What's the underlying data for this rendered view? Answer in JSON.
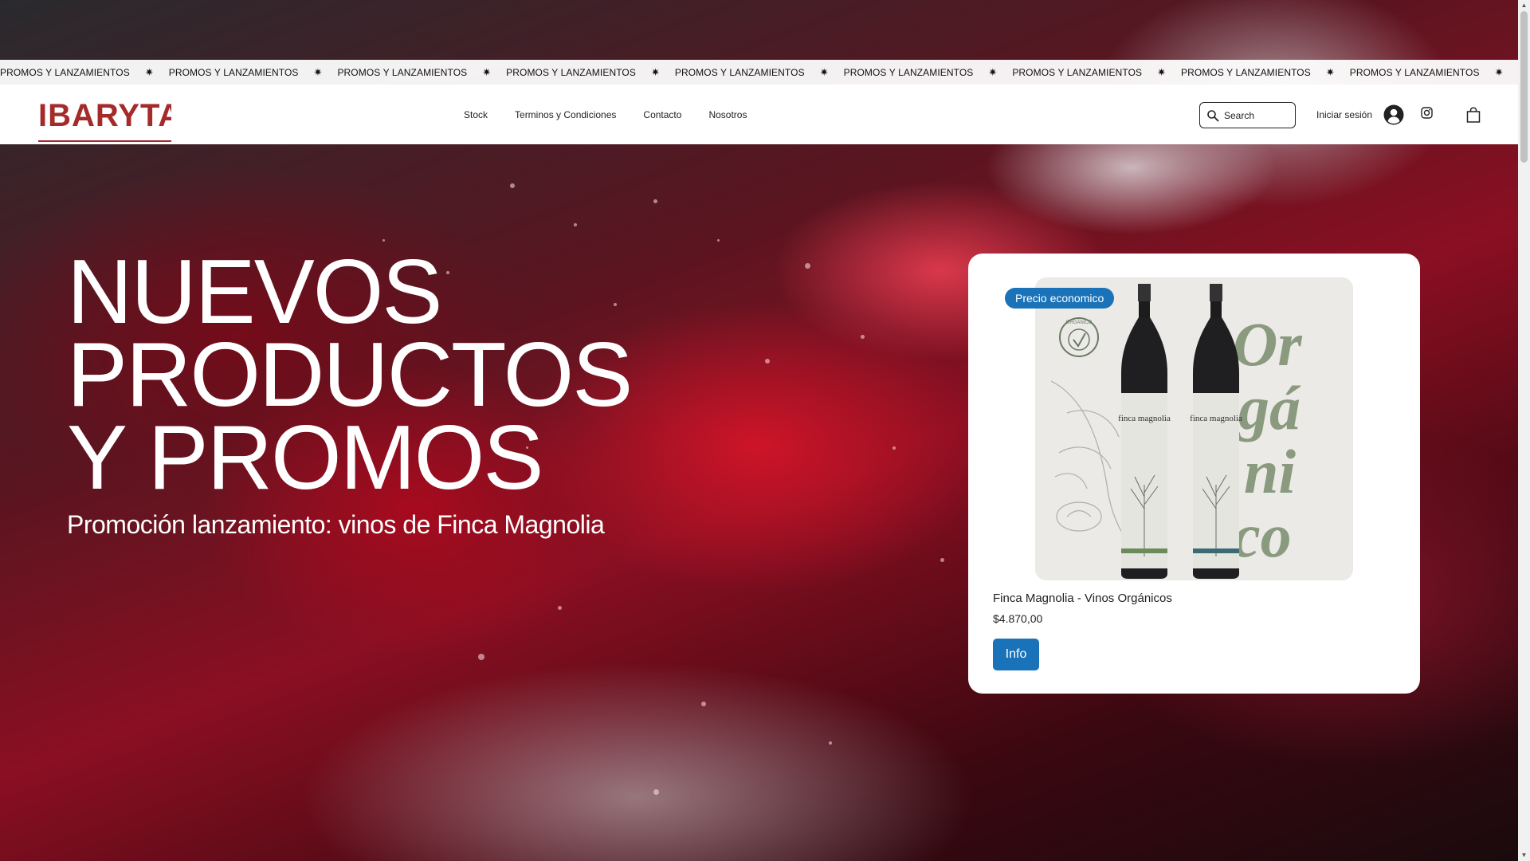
{
  "marquee": {
    "text": "PROMOS Y LANZAMIENTOS",
    "separator": "✷",
    "items": [
      "PROMOS Y LANZAMIENTOS",
      "PROMOS Y LANZAMIENTOS",
      "PROMOS Y LANZAMIENTOS",
      "PROMOS Y LANZAMIENTOS",
      "PROMOS Y LANZAMIENTOS",
      "PROMOS Y LANZAMIENTOS",
      "PROMOS Y LANZAMIENTOS",
      "PROMOS Y LANZAMIENTOS",
      "PROMOS Y LANZAMIENTOS",
      "PROMOS Y LANZAMIENTOS"
    ]
  },
  "header": {
    "logo_text": "IBARYTA",
    "nav": [
      {
        "label": "Stock"
      },
      {
        "label": "Terminos y Condiciones"
      },
      {
        "label": "Contacto"
      },
      {
        "label": "Nosotros"
      }
    ],
    "search_placeholder": "Search",
    "login_label": "Iniciar sesión",
    "icons": {
      "search": "search-icon",
      "avatar": "avatar-icon",
      "instagram": "instagram-icon",
      "cart": "shopping-bag-icon"
    }
  },
  "hero": {
    "title_lines": [
      "NUEVOS",
      "PRODUCTOS",
      "Y PROMOS"
    ],
    "subtitle": "Promoción lanzamiento: vinos de Finca Magnolia"
  },
  "product": {
    "badge": "Precio economico",
    "name": "Finca Magnolia - Vinos Orgánicos",
    "price": "$4.870,00",
    "button_label": "Info",
    "image_text": {
      "big_word": [
        "Or",
        "gá",
        "ni",
        "co"
      ],
      "seal": "ORGÁNICO",
      "bottle_label": "finca magnolia"
    }
  },
  "colors": {
    "accent": "#1a73b8",
    "logo": "#a52a2a"
  }
}
